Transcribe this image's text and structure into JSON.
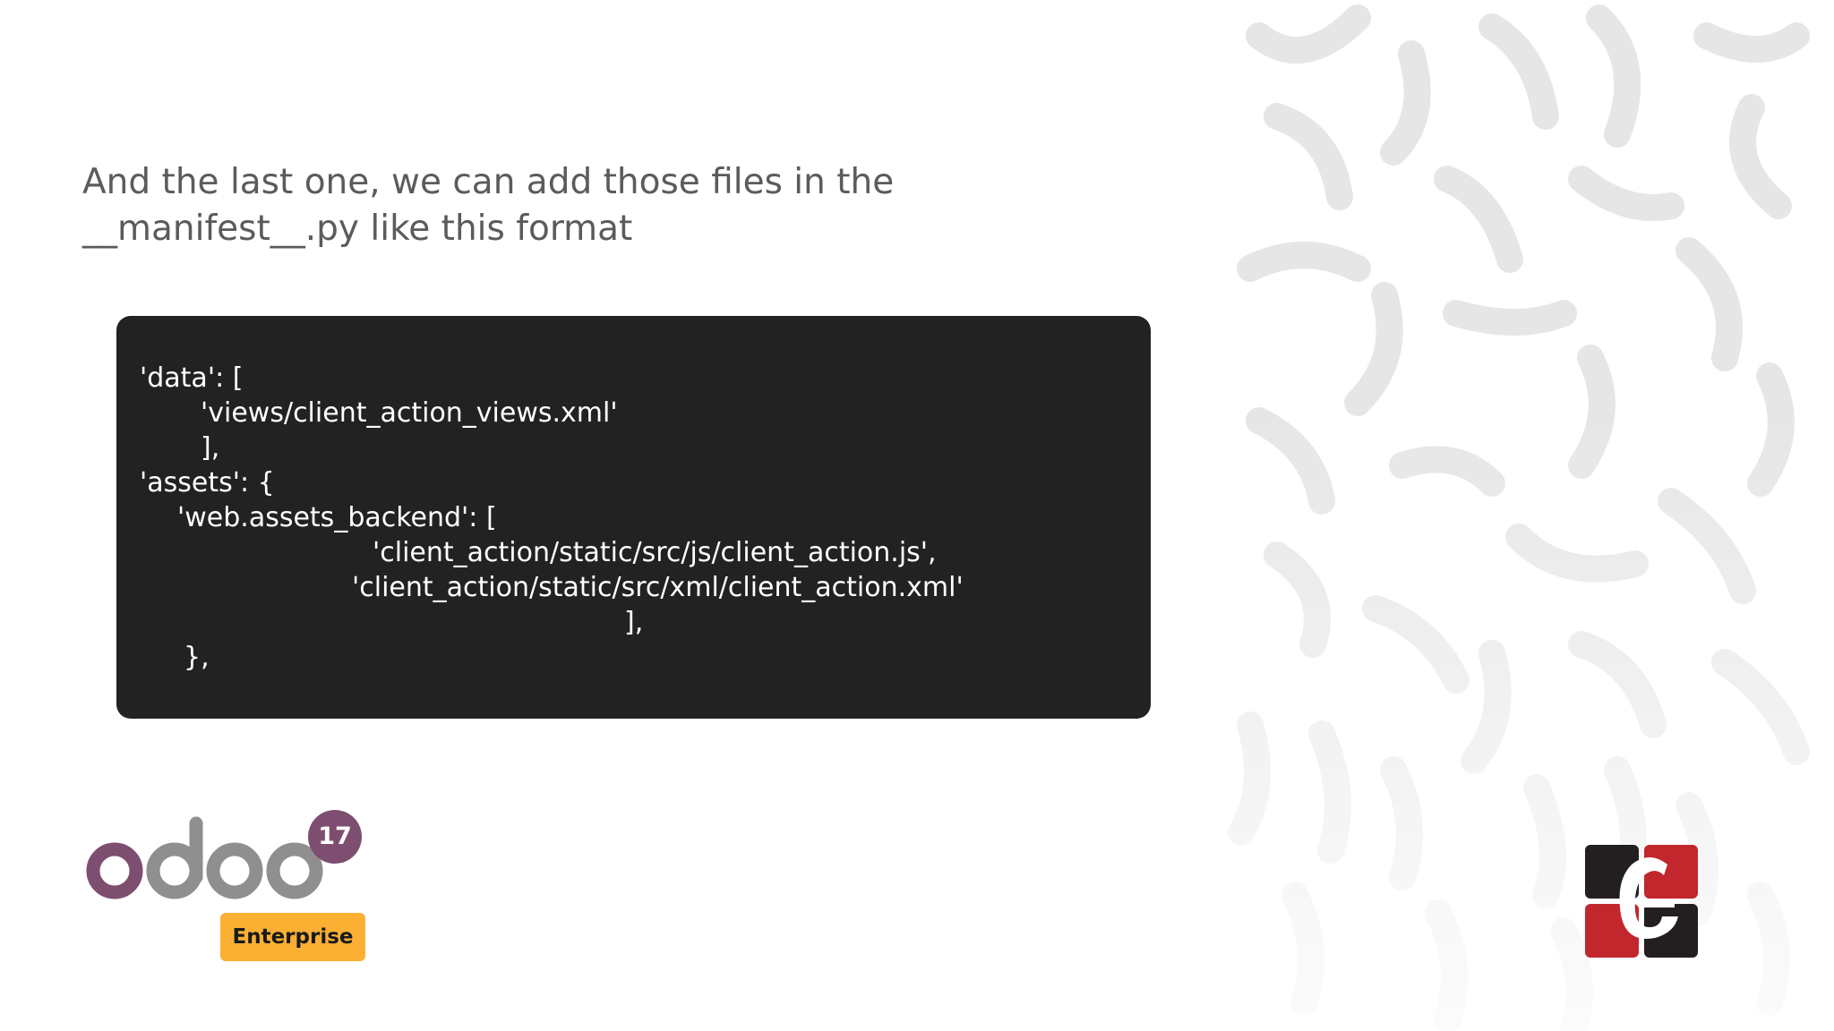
{
  "slide": {
    "heading": "And the last one, we can add those files in the __manifest__.py like this format"
  },
  "code": {
    "lines": [
      "'data': [",
      "'views/client_action_views.xml'",
      "],",
      "'assets': {",
      "'web.assets_backend': [",
      "'client_action/static/src/js/client_action.js',",
      "'client_action/static/src/xml/client_action.xml'",
      "],",
      "},"
    ]
  },
  "logo": {
    "wordmark": "odoo",
    "version": "17",
    "edition": "Enterprise",
    "colors": {
      "purple": "#7d4e6f",
      "gray": "#8f8f8f",
      "badge_bg": "#fbb034"
    }
  },
  "brand_logo": {
    "icon": "cybrosys-logo-icon",
    "colors": {
      "red": "#c1272d",
      "dark": "#231f20"
    }
  },
  "colors": {
    "heading": "#5b5b5b",
    "code_bg": "#222222",
    "code_text": "#ffffff"
  }
}
